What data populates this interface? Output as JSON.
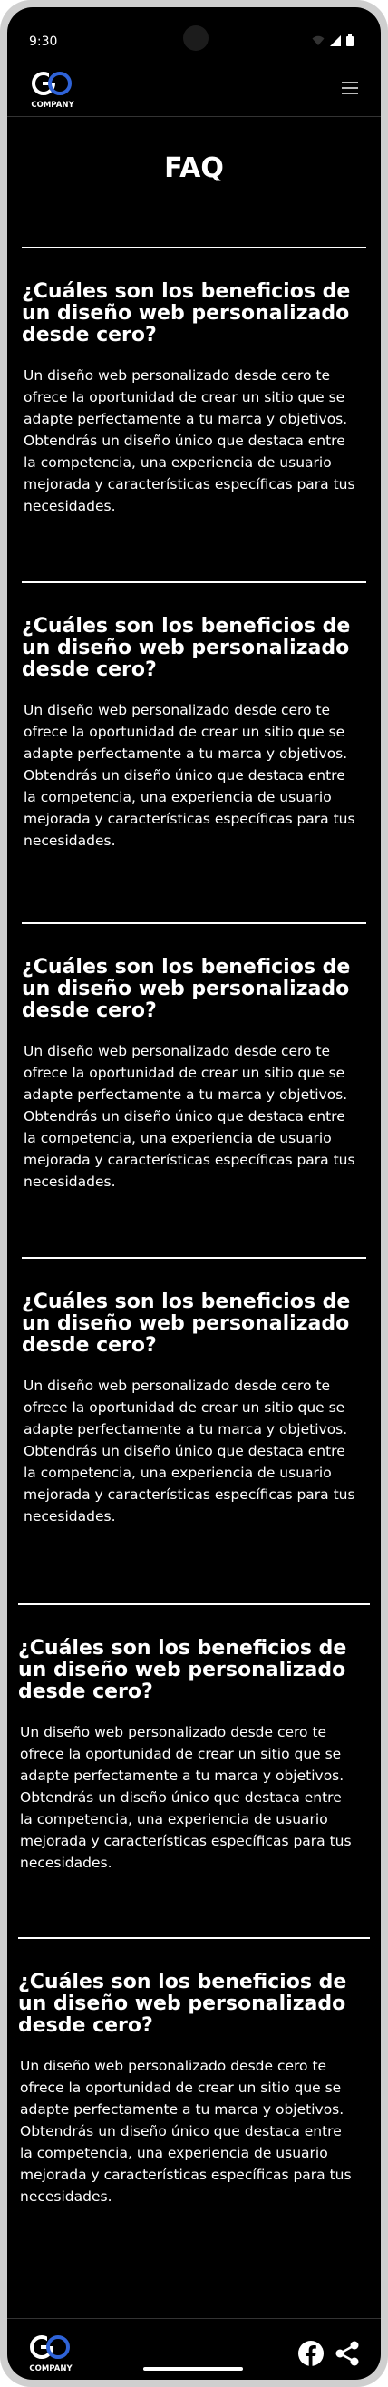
{
  "status_bar": {
    "time": "9:30",
    "icons": [
      "wifi-icon",
      "signal-icon",
      "battery-icon"
    ]
  },
  "header": {
    "logo_initials": "GO",
    "logo_text": "COMPANY",
    "menu_icon": "hamburger-menu-icon"
  },
  "page": {
    "title": "FAQ"
  },
  "faq": [
    {
      "question": "¿Cuáles son los beneficios de un diseño web personalizado desde cero?",
      "answer": "Un diseño web personalizado desde cero te ofrece la oportunidad de crear un sitio que se adapte perfectamente a tu marca y objetivos. Obtendrás un diseño único que destaca entre la competencia, una experiencia de usuario mejorada y características específicas para tus necesidades."
    },
    {
      "question": "¿Cuáles son los beneficios de un diseño web personalizado desde cero?",
      "answer": "Un diseño web personalizado desde cero te ofrece la oportunidad de crear un sitio que se adapte perfectamente a tu marca y objetivos. Obtendrás un diseño único que destaca entre la competencia, una experiencia de usuario mejorada y características específicas para tus necesidades."
    },
    {
      "question": "¿Cuáles son los beneficios de un diseño web personalizado desde cero?",
      "answer": "Un diseño web personalizado desde cero te ofrece la oportunidad de crear un sitio que se adapte perfectamente a tu marca y objetivos. Obtendrás un diseño único que destaca entre la competencia, una experiencia de usuario mejorada y características específicas para tus necesidades."
    },
    {
      "question": "¿Cuáles son los beneficios de un diseño web personalizado desde cero?",
      "answer": "Un diseño web personalizado desde cero te ofrece la oportunidad de crear un sitio que se adapte perfectamente a tu marca y objetivos. Obtendrás un diseño único que destaca entre la competencia, una experiencia de usuario mejorada y características específicas para tus necesidades."
    },
    {
      "question": "¿Cuáles son los beneficios de un diseño web personalizado desde cero?",
      "answer": "Un diseño web personalizado desde cero te ofrece la oportunidad de crear un sitio que se adapte perfectamente a tu marca y objetivos. Obtendrás un diseño único que destaca entre la competencia, una experiencia de usuario mejorada y características específicas para tus necesidades."
    },
    {
      "question": "¿Cuáles son los beneficios de un diseño web personalizado desde cero?",
      "answer": "Un diseño web personalizado desde cero te ofrece la oportunidad de crear un sitio que se adapte perfectamente a tu marca y objetivos. Obtendrás un diseño único que destaca entre la competencia, una experiencia de usuario mejorada y características específicas para tus necesidades."
    }
  ],
  "footer": {
    "logo_initials": "GO",
    "logo_text": "COMPANY",
    "icons": [
      "facebook-icon",
      "share-icon"
    ]
  },
  "colors": {
    "background": "#000000",
    "text": "#ffffff",
    "brand_blue": "#2f63d8"
  }
}
